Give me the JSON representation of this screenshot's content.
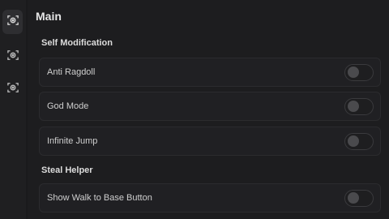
{
  "sidebar": {
    "items": [
      {
        "icon": "target-icon",
        "active": true
      },
      {
        "icon": "target-icon",
        "active": false
      },
      {
        "icon": "target-icon",
        "active": false
      }
    ]
  },
  "main": {
    "title": "Main",
    "sections": [
      {
        "label": "Self Modification",
        "toggles": [
          {
            "label": "Anti Ragdoll",
            "on": false
          },
          {
            "label": "God Mode",
            "on": false
          },
          {
            "label": "Infinite Jump",
            "on": false
          }
        ]
      },
      {
        "label": "Steal Helper",
        "toggles": [
          {
            "label": "Show Walk to Base Button",
            "on": false
          }
        ]
      }
    ]
  },
  "colors": {
    "panel_bg": "#1d1d1f",
    "row_bg": "#202023",
    "toggle_off": "#4a4a4d"
  }
}
